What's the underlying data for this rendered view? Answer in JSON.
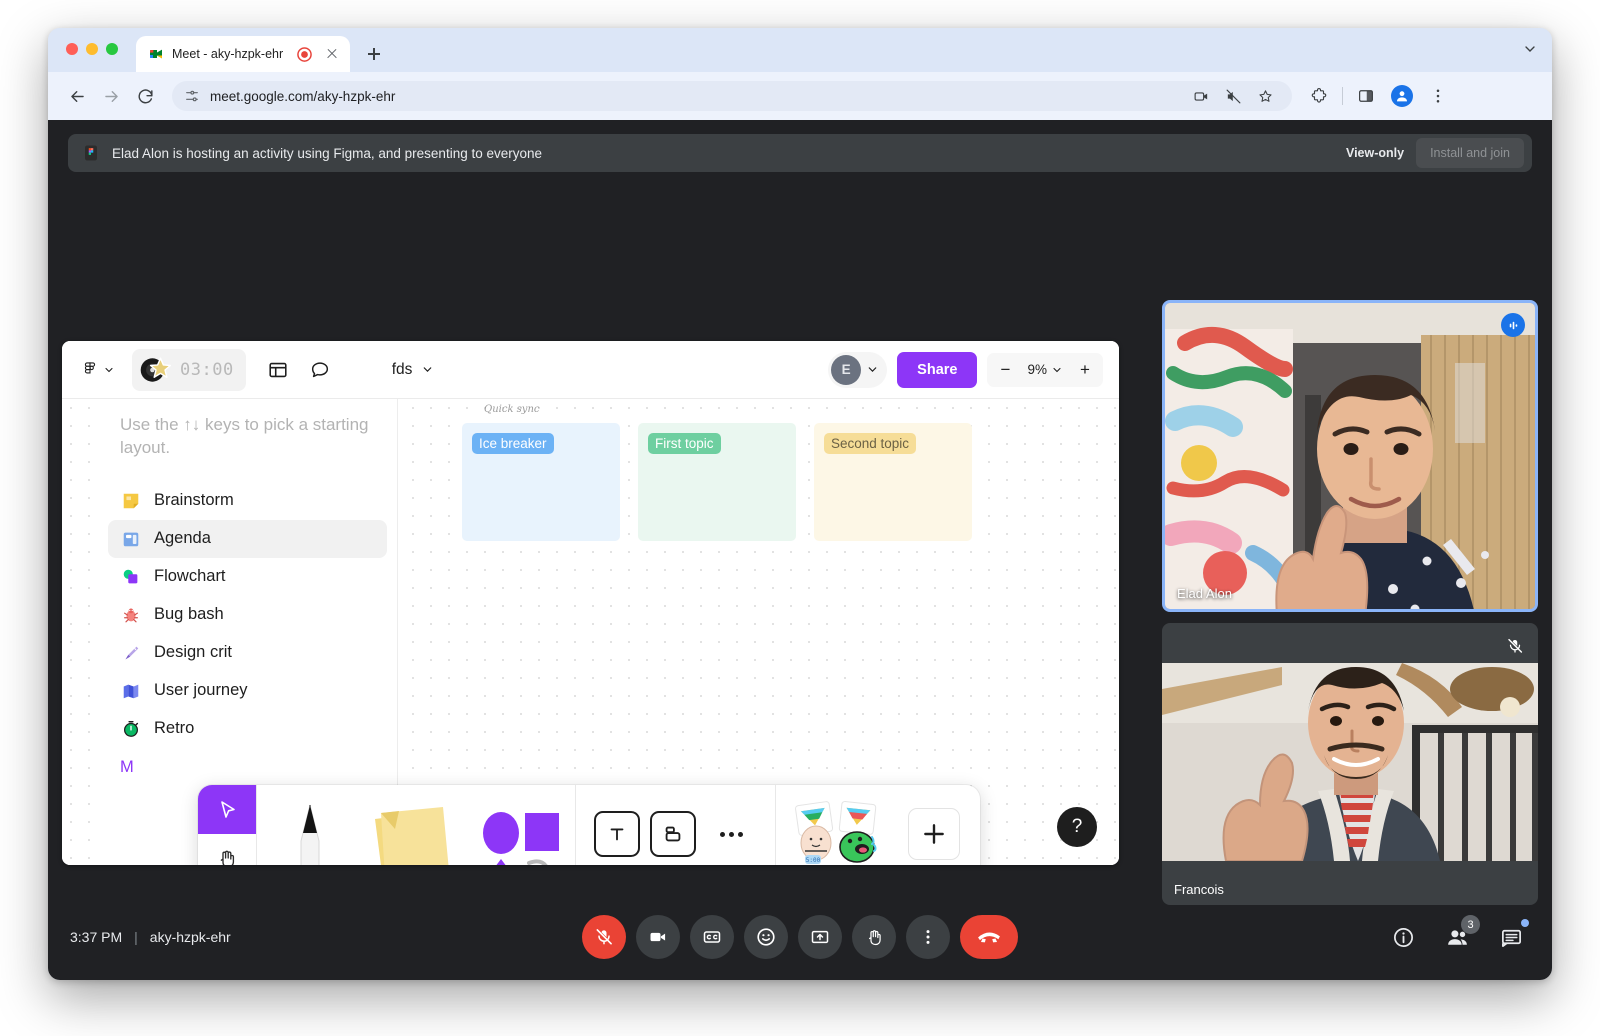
{
  "browser": {
    "tab": {
      "title": "Meet - aky-hzpk-ehr",
      "favicon": "google-meet-icon",
      "recording_indicator": "recording-icon"
    },
    "new_tab_label": "+",
    "url": "meet.google.com/aky-hzpk-ehr",
    "nav": {
      "back": "back-icon",
      "forward": "forward-icon",
      "reload": "reload-icon"
    },
    "toolbar_icons": [
      "camera-icon",
      "speaker-muted-icon",
      "bookmark-star-icon",
      "extensions-icon",
      "side-panel-icon",
      "profile-avatar-icon",
      "browser-menu-icon"
    ]
  },
  "banner": {
    "icon": "figma-icon",
    "text": "Elad Alon is hosting an activity using Figma, and presenting to everyone",
    "view_only_label": "View-only",
    "install_label": "Install and join"
  },
  "figma": {
    "logo": "figma-logo-icon",
    "timer": {
      "value": "03:00",
      "emoji": "vinyl-record-star-icon"
    },
    "layout_icon": "layout-grid-icon",
    "comment_icon": "comment-bubble-icon",
    "file_name": "fds",
    "user_initial": "E",
    "share_label": "Share",
    "zoom": {
      "minus": "−",
      "value": "9%",
      "plus": "+"
    },
    "panel": {
      "hint": "Use the ↑↓ keys to pick a starting layout.",
      "more_label": "M",
      "items": [
        {
          "label": "Brainstorm",
          "icon": "sticky-note-icon",
          "selected": false
        },
        {
          "label": "Agenda",
          "icon": "agenda-board-icon",
          "selected": true
        },
        {
          "label": "Flowchart",
          "icon": "flowchart-shapes-icon",
          "selected": false
        },
        {
          "label": "Bug bash",
          "icon": "bug-icon",
          "selected": false
        },
        {
          "label": "Design crit",
          "icon": "pen-nib-icon",
          "selected": false
        },
        {
          "label": "User journey",
          "icon": "map-icon",
          "selected": false
        },
        {
          "label": "Retro",
          "icon": "stopwatch-icon",
          "selected": false
        }
      ]
    },
    "board": {
      "title": "Quick sync",
      "cards": [
        {
          "label": "Ice breaker",
          "chip_color": "#6cb2f5",
          "bg_color": "#e8f3fd"
        },
        {
          "label": "First topic",
          "chip_color": "#6ecfa0",
          "bg_color": "#eaf7f0"
        },
        {
          "label": "Second topic",
          "chip_color": "#f6dd97",
          "bg_color": "#fdf7e6",
          "text_color": "#6b6145"
        }
      ]
    },
    "toolbar": {
      "cursor_icon": "cursor-arrow-icon",
      "hand_icon": "hand-pan-icon",
      "marker_icon": "marker-pen-icon",
      "sticky_icon": "sticky-notes-icon",
      "shapes_icon": "shapes-icon",
      "text_icon": "text-tool-icon",
      "section_icon": "section-tool-icon",
      "more_icon": "more-tools-icon",
      "stickers_icon": "stickers-icon",
      "add_icon": "add-widget-icon"
    },
    "help_label": "?"
  },
  "participants": [
    {
      "name": "Elad Alon",
      "active_speaker": true,
      "muted": false,
      "badge": "audio-active-icon"
    },
    {
      "name": "Francois",
      "active_speaker": false,
      "muted": true,
      "badge": "mic-off-icon"
    }
  ],
  "bottom_bar": {
    "time": "3:37 PM",
    "separator": "|",
    "meeting_code": "aky-hzpk-ehr",
    "controls": [
      {
        "name": "microphone-muted-button",
        "icon": "mic-off-icon",
        "state": "muted"
      },
      {
        "name": "camera-button",
        "icon": "camera-icon",
        "state": "on"
      },
      {
        "name": "captions-button",
        "icon": "closed-captions-icon",
        "state": "off"
      },
      {
        "name": "reactions-button",
        "icon": "emoji-smiley-icon",
        "state": "off"
      },
      {
        "name": "present-button",
        "icon": "present-screen-icon",
        "state": "off"
      },
      {
        "name": "raise-hand-button",
        "icon": "raised-hand-icon",
        "state": "off"
      },
      {
        "name": "more-options-button",
        "icon": "more-vertical-icon",
        "state": "off"
      },
      {
        "name": "end-call-button",
        "icon": "end-call-icon",
        "state": "danger"
      }
    ],
    "right_icons": [
      {
        "name": "meeting-details-button",
        "icon": "info-circle-icon"
      },
      {
        "name": "participants-button",
        "icon": "people-icon",
        "count": "3"
      },
      {
        "name": "chat-button",
        "icon": "chat-bubble-icon",
        "unread": true
      }
    ]
  }
}
